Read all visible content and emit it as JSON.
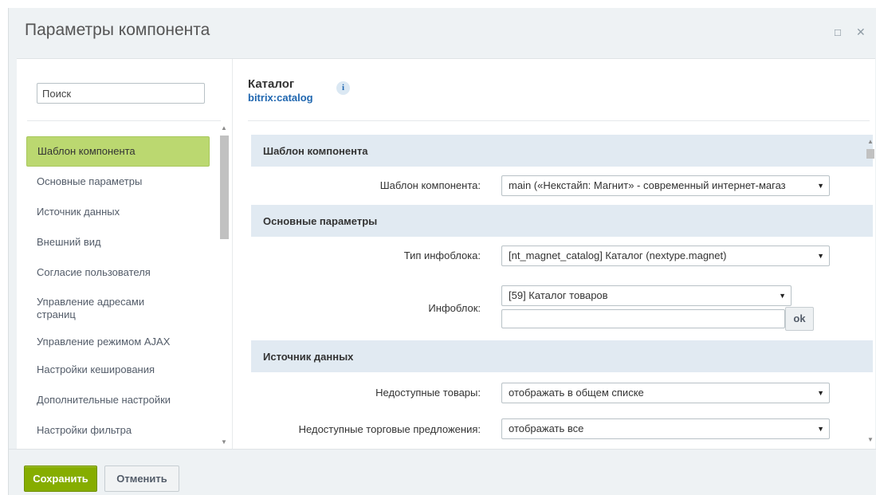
{
  "window": {
    "title": "Параметры компонента",
    "max_icon": "maximize-icon",
    "close_icon": "close-icon"
  },
  "search": {
    "placeholder": "Поиск",
    "value": ""
  },
  "sidebar": {
    "items": [
      {
        "label": "Шаблон компонента",
        "active": true
      },
      {
        "label": "Основные параметры"
      },
      {
        "label": "Источник данных"
      },
      {
        "label": "Внешний вид"
      },
      {
        "label": "Согласие пользователя"
      },
      {
        "label": "Управление адресами страниц"
      },
      {
        "label": "Управление режимом AJAX"
      },
      {
        "label": "Настройки кеширования"
      },
      {
        "label": "Дополнительные настройки"
      },
      {
        "label": "Настройки фильтра"
      }
    ]
  },
  "component": {
    "name": "Каталог",
    "code": "bitrix:catalog",
    "info_glyph": "i"
  },
  "sections": {
    "template": {
      "title": "Шаблон компонента",
      "template_label": "Шаблон компонента:",
      "template_value": "main («Некстайп: Магнит» - современный интернет-магаз"
    },
    "basic": {
      "title": "Основные параметры",
      "iblock_type_label": "Тип инфоблока:",
      "iblock_type_value": "[nt_magnet_catalog] Каталог (nextype.magnet)",
      "iblock_label": "Инфоблок:",
      "iblock_value": "[59] Каталог товаров",
      "iblock_input": "",
      "ok_label": "ok"
    },
    "source": {
      "title": "Источник данных",
      "unavailable_label": "Недоступные товары:",
      "unavailable_value": "отображать в общем списке",
      "unavailable_offers_label": "Недоступные торговые предложения:",
      "unavailable_offers_value": "отображать все"
    }
  },
  "footer": {
    "save_label": "Сохранить",
    "cancel_label": "Отменить"
  },
  "colors": {
    "active_nav": "#bbd870",
    "save_button": "#86ad00",
    "section_header": "#e1eaf2",
    "link_blue": "#2067b0"
  }
}
